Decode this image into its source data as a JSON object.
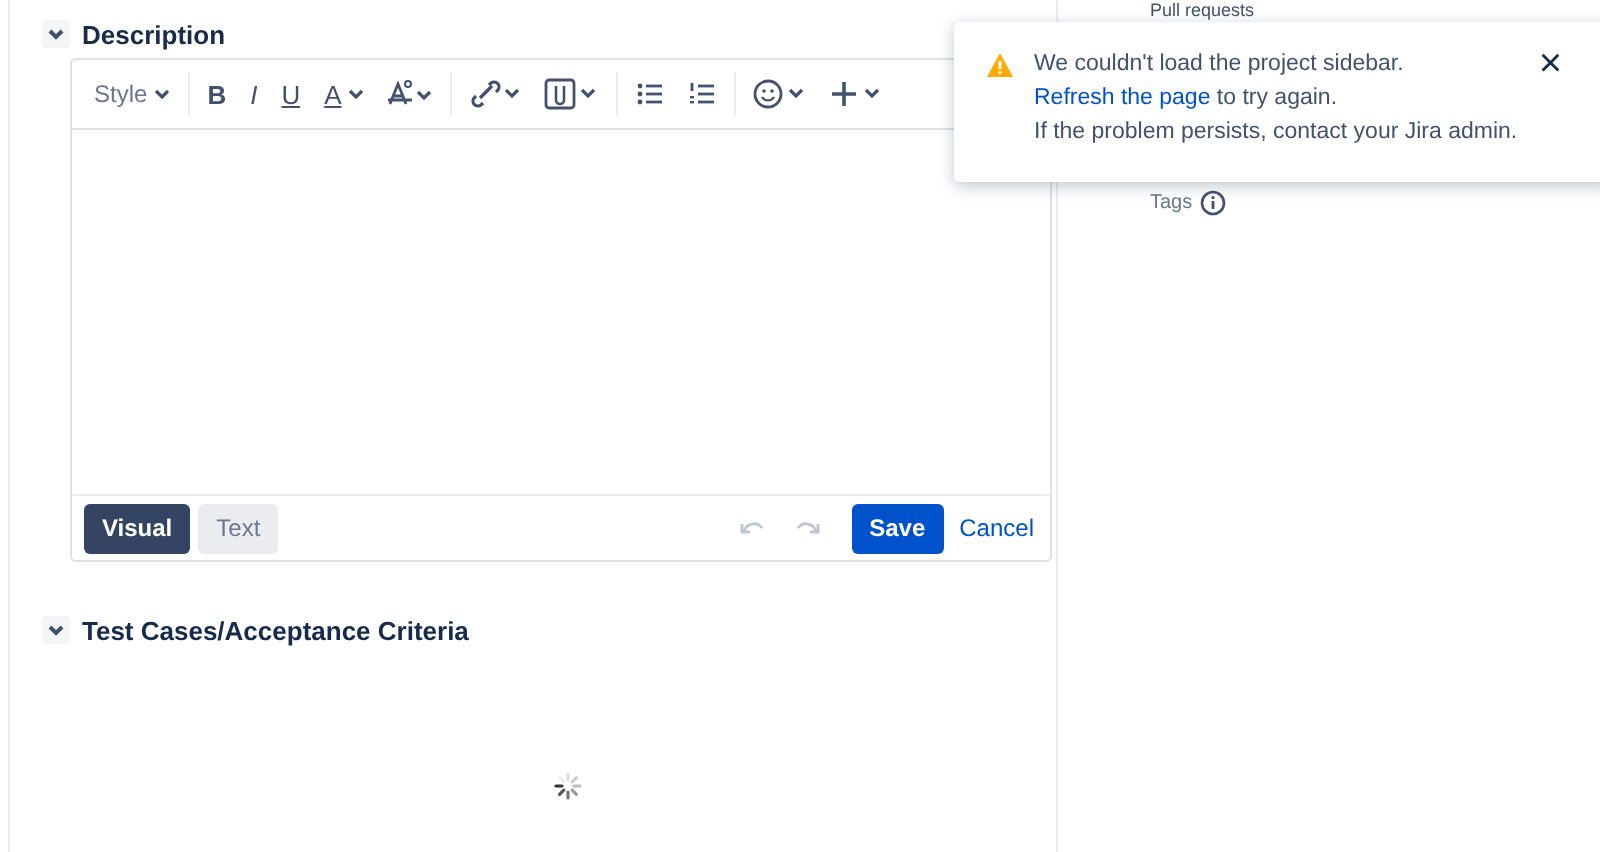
{
  "sections": [
    {
      "title": "Description",
      "expanded": true
    },
    {
      "title": "Test Cases/Acceptance Criteria",
      "expanded": true
    }
  ],
  "editor": {
    "style_label": "Style",
    "format_buttons": [
      {
        "kind": "bold",
        "label": "B"
      },
      {
        "kind": "italic",
        "label": "I"
      },
      {
        "kind": "underline",
        "label": "U"
      },
      {
        "kind": "color",
        "label": "A"
      }
    ],
    "modes": [
      {
        "label": "Visual",
        "selected": true
      },
      {
        "label": "Text",
        "selected": false
      }
    ],
    "save": "Save",
    "cancel": "Cancel"
  },
  "sidebar": {
    "cut_heading": "Pull requests",
    "tags_label": "Tags"
  },
  "toast": {
    "message_before": "We couldn't load the project sidebar.",
    "link": "Refresh the page",
    "message_after": "to try again.",
    "line_2": "If the problem persists, contact your Jira admin.",
    "close": "×"
  }
}
